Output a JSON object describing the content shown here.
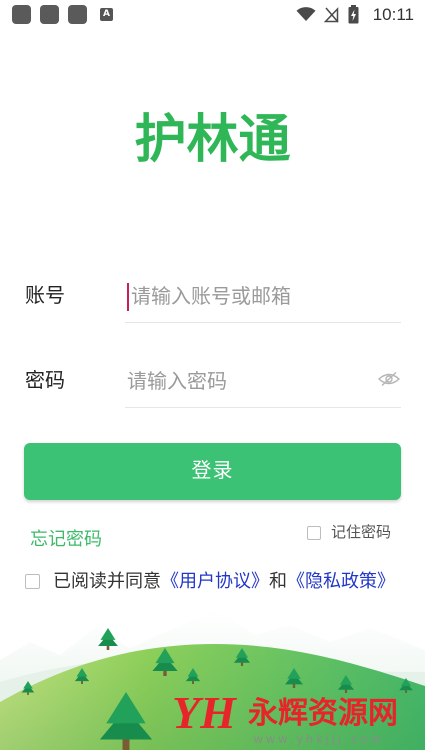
{
  "status_bar": {
    "time": "10:11",
    "a_icon_label": "A",
    "icons": [
      "notification-icon",
      "notification-icon",
      "notification-icon",
      "a-icon",
      "wifi-icon",
      "no-signal-icon",
      "battery-charging-icon"
    ]
  },
  "app": {
    "title": "护林通"
  },
  "form": {
    "account": {
      "label": "账号",
      "placeholder": "请输入账号或邮箱",
      "value": ""
    },
    "password": {
      "label": "密码",
      "placeholder": "请输入密码",
      "value": "",
      "visibility_icon": "eye-off-icon"
    },
    "login_button": "登录",
    "forgot_password": "忘记密码",
    "remember_password": {
      "label": "记住密码",
      "checked": false
    }
  },
  "agreement": {
    "checked": false,
    "prefix": "已阅读并同意",
    "user_agreement": "《用户协议》",
    "conjunction": "和",
    "privacy_policy": "《隐私政策》"
  },
  "watermark": {
    "logo": "YH",
    "site_name": "永辉资源网",
    "url": "www.yhkjjj.com"
  },
  "colors": {
    "primary": "#3cc274",
    "title": "#2fb757",
    "link": "#2236c8",
    "cursor": "#c51f5d",
    "watermark": "#e62429"
  }
}
